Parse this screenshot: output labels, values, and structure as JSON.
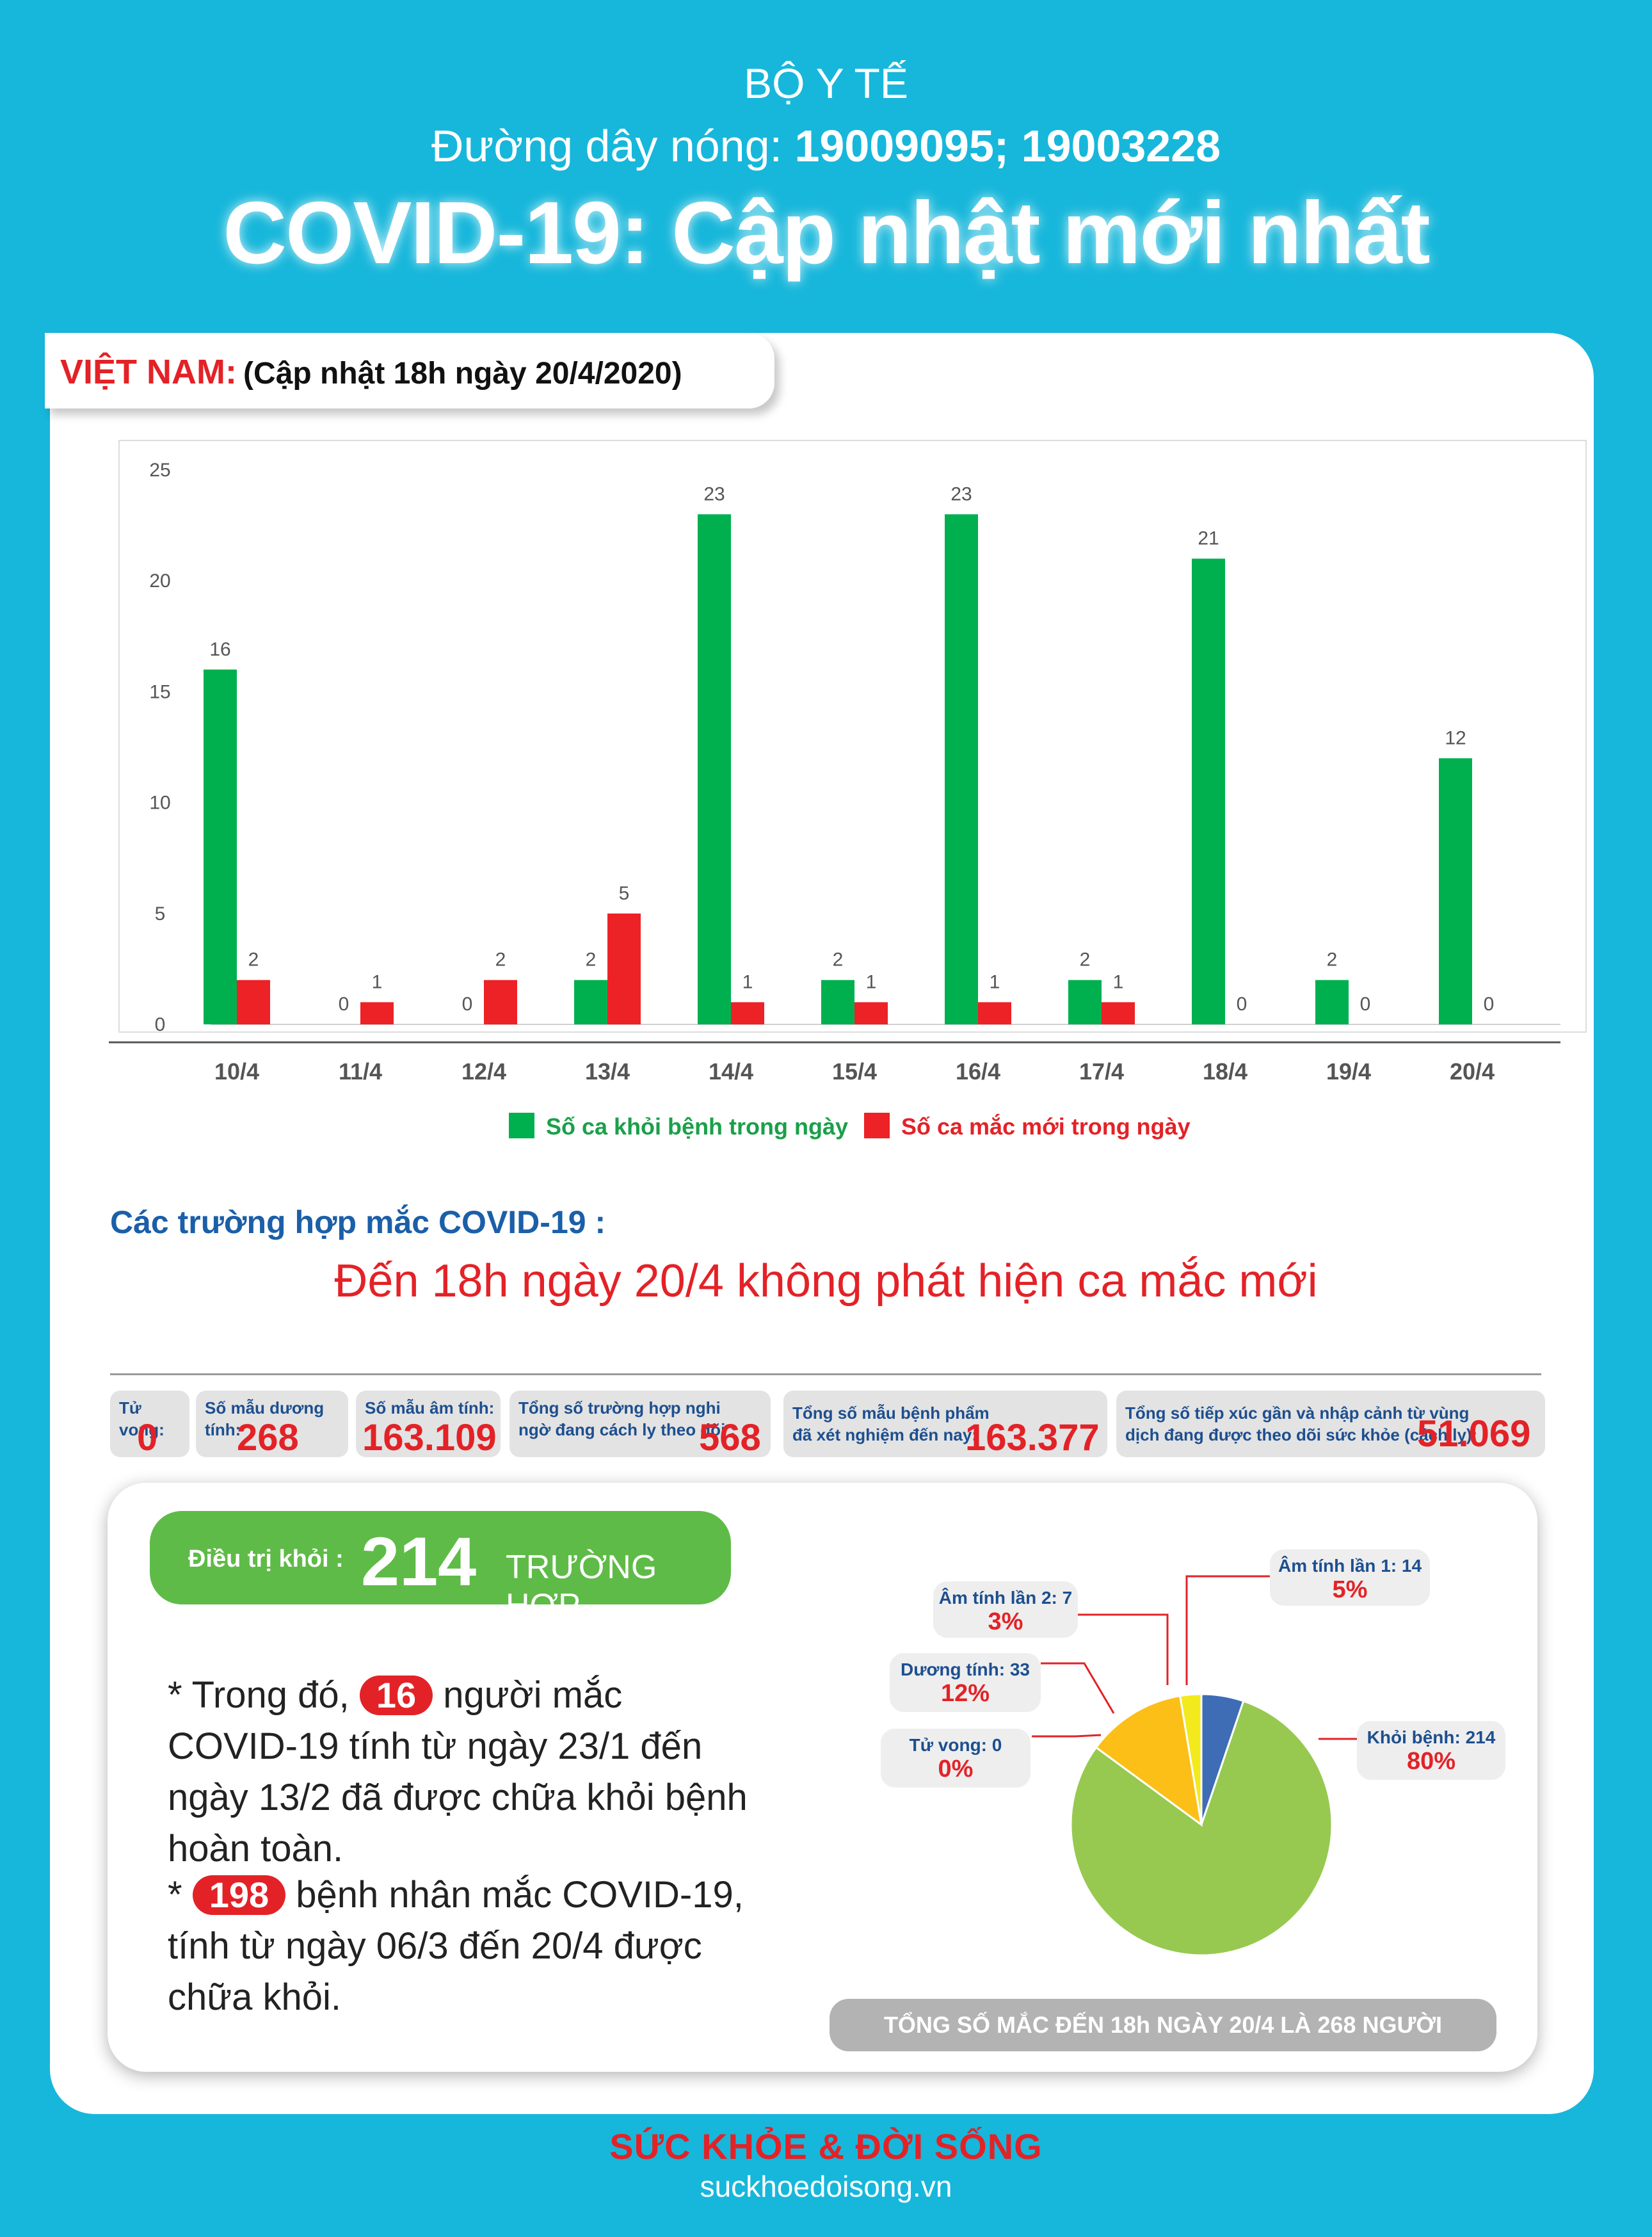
{
  "header": {
    "ministry": "BỘ Y TẾ",
    "hotline_prefix": "Đường dây nóng: ",
    "hotline_numbers": "19009095; 19003228",
    "headline": "COVID-19: Cập nhật mới nhất"
  },
  "update": {
    "country": "VIỆT NAM:",
    "time": "(Cập nhật 18h ngày 20/4/2020)"
  },
  "chart_data": {
    "type": "bar",
    "categories": [
      "10/4",
      "11/4",
      "12/4",
      "13/4",
      "14/4",
      "15/4",
      "16/4",
      "17/4",
      "18/4",
      "19/4",
      "20/4"
    ],
    "series": [
      {
        "name": "Số ca khỏi bệnh trong ngày",
        "values": [
          16,
          0,
          0,
          2,
          23,
          2,
          23,
          2,
          21,
          2,
          12
        ],
        "color": "#00b04f"
      },
      {
        "name": "Số ca mắc mới  trong ngày",
        "values": [
          2,
          1,
          2,
          5,
          1,
          1,
          1,
          1,
          0,
          0,
          0
        ],
        "color": "#ec2227"
      }
    ],
    "ylim": [
      0,
      25
    ],
    "yticks": [
      0,
      5,
      10,
      15,
      20,
      25
    ],
    "grid": false,
    "legend": "bottom"
  },
  "cases": {
    "title": "Các trường hợp mắc COVID-19 :",
    "message": "Đến 18h ngày 20/4 không phát hiện ca mắc mới"
  },
  "stats": {
    "deaths_label": "Tử vong:",
    "deaths": "0",
    "positive_label": "Số mẫu dương tính:",
    "positive": "268",
    "negative_label": "Số mẫu âm tính:",
    "negative": "163.109",
    "suspected_label_1": "Tổng số trường hợp nghi",
    "suspected_label_2": "ngờ đang cách ly theo dõi :",
    "suspected": "568",
    "tested_label_1": "Tổng số mẫu bệnh phẩm",
    "tested_label_2": "đã xét nghiệm đến nay:",
    "tested": "163.377",
    "contacts_label_1": "Tổng số tiếp xúc gần và nhập cảnh từ vùng",
    "contacts_label_2": "dịch đang được theo dõi sức khỏe (cách ly):",
    "contacts": "51.069"
  },
  "recovered": {
    "label": "Điều trị khỏi :",
    "count": "214",
    "unit": "TRƯỜNG HỢP",
    "para1_pre": "* Trong đó, ",
    "para1_num": "16",
    "para1_post": " người mắc COVID-19 tính từ ngày 23/1 đến ngày 13/2 đã được chữa khỏi bệnh hoàn toàn.",
    "para2_pre": "* ",
    "para2_num": "198",
    "para2_post": " bệnh nhân  mắc COVID-19, tính từ ngày 06/3 đến 20/4 được chữa khỏi."
  },
  "pie": {
    "chart_data": {
      "type": "pie",
      "slices": [
        {
          "label": "Khỏi bệnh: 214",
          "value": 214,
          "percent": "80%",
          "color": "#97c950"
        },
        {
          "label": "Dương tính: 33",
          "value": 33,
          "percent": "12%",
          "color": "#fbbf17"
        },
        {
          "label": "Âm tính lần 2: 7",
          "value": 7,
          "percent": "3%",
          "color": "#f2ea1d"
        },
        {
          "label": "Âm tính lần 1: 14",
          "value": 14,
          "percent": "5%",
          "color": "#3e6db5"
        },
        {
          "label": "Tử vong: 0",
          "value": 0,
          "percent": "0%",
          "color": "#e32227"
        }
      ]
    },
    "total": "TỔNG SỐ MẮC ĐẾN 18h NGÀY 20/4 LÀ 268 NGƯỜI"
  },
  "footer": {
    "brand": "SỨC KHỎE & ĐỜI SỐNG",
    "site": "suckhoedoisong.vn"
  }
}
